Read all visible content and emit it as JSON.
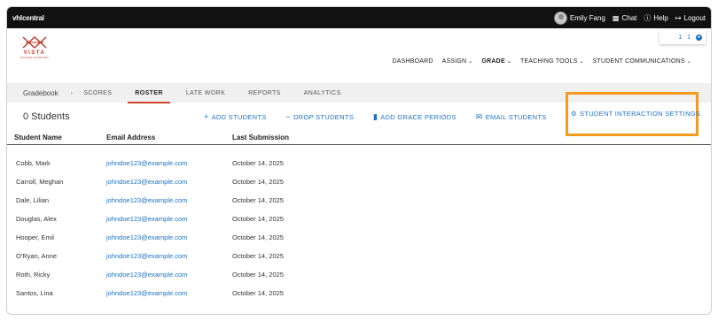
{
  "topbar": {
    "brand": "vhlcentral",
    "user": "Emily Fang",
    "chat": "Chat",
    "help": "Help",
    "logout": "Logout"
  },
  "logo": {
    "name": "VISTA",
    "sub": "HIGHER LEARNING"
  },
  "notif": {
    "a": "1",
    "b": "1"
  },
  "mainnav": [
    {
      "label": "DASHBOARD",
      "chevron": false
    },
    {
      "label": "ASSIGN",
      "chevron": true
    },
    {
      "label": "GRADE",
      "chevron": true,
      "active": true
    },
    {
      "label": "TEACHING TOOLS",
      "chevron": true
    },
    {
      "label": "STUDENT COMMUNICATIONS",
      "chevron": true
    }
  ],
  "tabs": {
    "gradebook": "Gradebook",
    "scores": "SCORES",
    "roster": "ROSTER",
    "late_work": "LATE WORK",
    "reports": "REPORTS",
    "analytics": "ANALYTICS"
  },
  "actions": {
    "count": "0 Students",
    "add": "ADD STUDENTS",
    "drop": "DROP STUDENTS",
    "grace": "ADD GRACE PERIODS",
    "email": "EMAIL STUDENTS",
    "settings": "STUDENT INTERACTION SETTINGS"
  },
  "table": {
    "headers": [
      "Student Name",
      "Email Address",
      "Last Submission"
    ],
    "rows": [
      [
        "Cobb, Mark",
        "johndoe123@example.com",
        "October 14, 2025"
      ],
      [
        "Carroll, Meghan",
        "johndoe123@example.com",
        "October 14, 2025"
      ],
      [
        "Dale, Lilian",
        "johndoe123@example.com",
        "October 14, 2025"
      ],
      [
        "Douglas, Alex",
        "johndoe123@example.com",
        "October 14, 2025"
      ],
      [
        "Hooper, Emil",
        "johndoe123@example.com",
        "October 14, 2025"
      ],
      [
        "O'Ryan, Anne",
        "johndoe123@example.com",
        "October 14, 2025"
      ],
      [
        "Roth, Ricky",
        "johndoe123@example.com",
        "October 14, 2025"
      ],
      [
        "Santos, Lina",
        "johndoe123@example.com",
        "October 14, 2025"
      ]
    ]
  },
  "colors": {
    "accent": "#1a73c8",
    "highlight": "#f39a1f",
    "active_tab": "#d2452b"
  }
}
